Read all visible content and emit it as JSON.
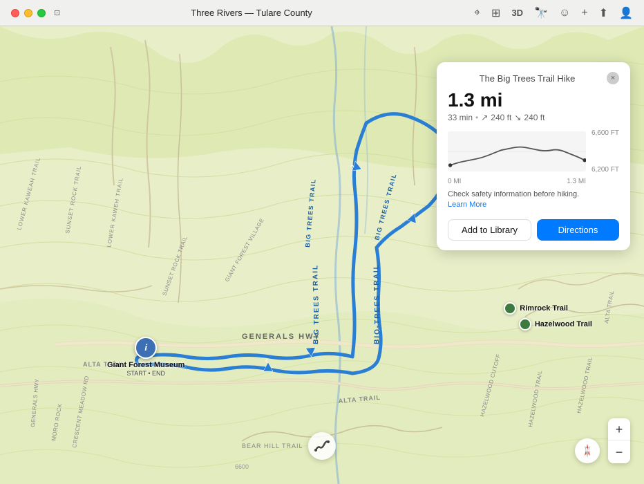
{
  "titleBar": {
    "title": "Three Rivers — Tulare County",
    "windowIcon": "⊞"
  },
  "toolbar": {
    "icons": [
      "location",
      "map",
      "3d",
      "binoculars",
      "face",
      "plus",
      "share",
      "account"
    ],
    "labels": [
      "3D"
    ]
  },
  "map": {
    "region": "Three Rivers, Tulare County",
    "trailName": "Big Trees Trail",
    "landmarks": [
      {
        "name": "Giant Forest Museum",
        "sub": "START • END",
        "type": "museum"
      },
      {
        "name": "Rimrock Trail",
        "type": "trail"
      },
      {
        "name": "Hazelwood Trail",
        "type": "trail"
      }
    ],
    "roads": [
      "Generals Hwy",
      "Alta Trail",
      "Bear Hill Trail",
      "Alta Trail"
    ]
  },
  "infoCard": {
    "title": "The Big Trees Trail Hike",
    "closeLabel": "×",
    "distance": "1.3 mi",
    "duration": "33 min",
    "elevationUp": "240 ft",
    "elevationDown": "240 ft",
    "elevationHigh": "6,600 FT",
    "elevationLow": "6,200 FT",
    "distanceStart": "0 MI",
    "distanceEnd": "1.3 MI",
    "safetyText": "Check safety information before hiking.",
    "learnMoreLabel": "Learn More",
    "addToLibraryLabel": "Add to Library",
    "directionsLabel": "Directions",
    "metaSeparator": "•",
    "arrowUp": "↗",
    "arrowDown": "↘"
  },
  "mapControls": {
    "zoomIn": "+",
    "zoomOut": "−",
    "north": "N",
    "northArrow": "↑",
    "trailIcon": "〜"
  }
}
